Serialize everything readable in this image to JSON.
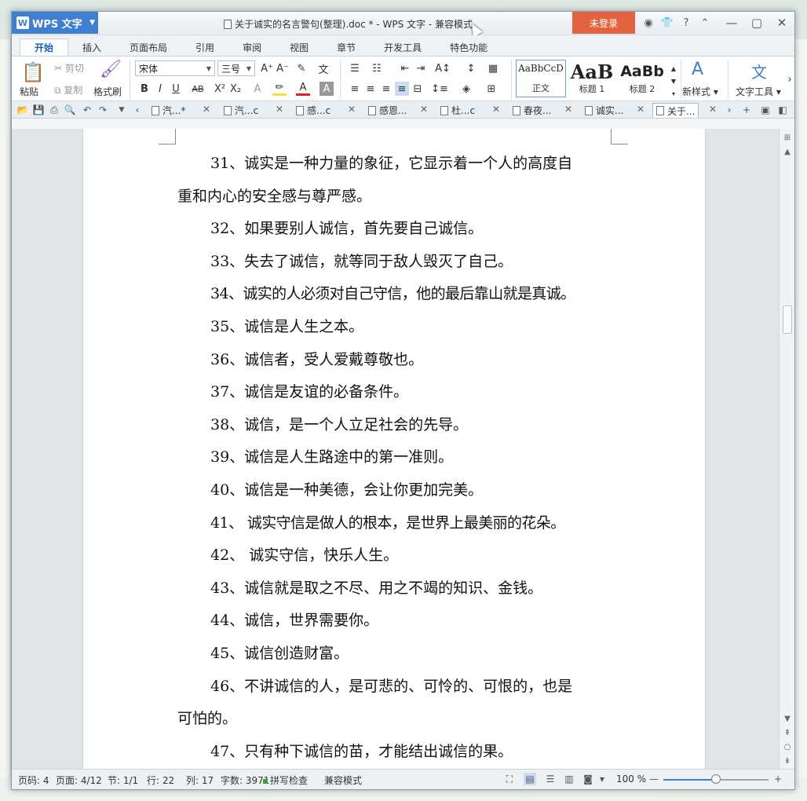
{
  "app": {
    "name": "WPS 文字",
    "window_title": "关于诚实的名言警句(整理).doc * - WPS 文字 - 兼容模式",
    "login_label": "未登录"
  },
  "menu": {
    "tabs": [
      "开始",
      "插入",
      "页面布局",
      "引用",
      "审阅",
      "视图",
      "章节",
      "开发工具",
      "特色功能"
    ]
  },
  "ribbon": {
    "paste": "粘贴",
    "cut": "剪切",
    "copy": "复制",
    "format_painter": "格式刷",
    "font_name": "宋体",
    "font_size": "三号",
    "styles": [
      {
        "preview": "AaBbCcD",
        "label": "正文"
      },
      {
        "preview": "AaB",
        "label": "标题 1"
      },
      {
        "preview": "AaBb",
        "label": "标题 2"
      }
    ],
    "new_style": "新样式",
    "text_tools": "文字工具"
  },
  "doc_tabs": [
    {
      "label": "汽...*",
      "active": false
    },
    {
      "label": "汽...c",
      "active": false
    },
    {
      "label": "感...c",
      "active": false
    },
    {
      "label": "感恩...",
      "active": false
    },
    {
      "label": "杜...c",
      "active": false
    },
    {
      "label": "春夜...",
      "active": false
    },
    {
      "label": "诚实...",
      "active": false
    },
    {
      "label": "关于...",
      "active": true
    }
  ],
  "document": {
    "paragraphs": [
      "31、诚实是一种力量的象征，它显示着一个人的高度自",
      "重和内心的安全感与尊严感。",
      "32、如果要别人诚信，首先要自己诚信。",
      "33、失去了诚信，就等同于敌人毁灭了自己。",
      "34、诚实的人必须对自己守信，他的最后靠山就是真诚。",
      "35、诚信是人生之本。",
      "36、诚信者，受人爱戴尊敬也。",
      "37、诚信是友谊的必备条件。",
      "38、诚信，是一个人立足社会的先导。",
      "39、诚信是人生路途中的第一准则。",
      "40、诚信是一种美德，会让你更加完美。",
      "41、  诚实守信是做人的根本，是世界上最美丽的花朵。",
      "42、  诚实守信，快乐人生。",
      "43、诚信就是取之不尽、用之不竭的知识、金钱。",
      "44、诚信，世界需要你。",
      "45、诚信创造财富。",
      "46、不讲诚信的人，是可悲的、可怜的、可恨的，也是",
      "可怕的。",
      "47、只有种下诚信的苗，才能结出诚信的果。"
    ]
  },
  "status": {
    "page_code": "页码: 4",
    "pages": "页面: 4/12",
    "section": "节: 1/1",
    "row": "行: 22",
    "col": "列: 17",
    "word_count": "字数: 3971",
    "spell_check": "拼写检查",
    "compat_mode": "兼容模式",
    "zoom": "100 %",
    "zoom_fraction": 0.5
  },
  "colors": {
    "accent_blue": "#3f7fd0",
    "login_orange": "#e3633f"
  }
}
